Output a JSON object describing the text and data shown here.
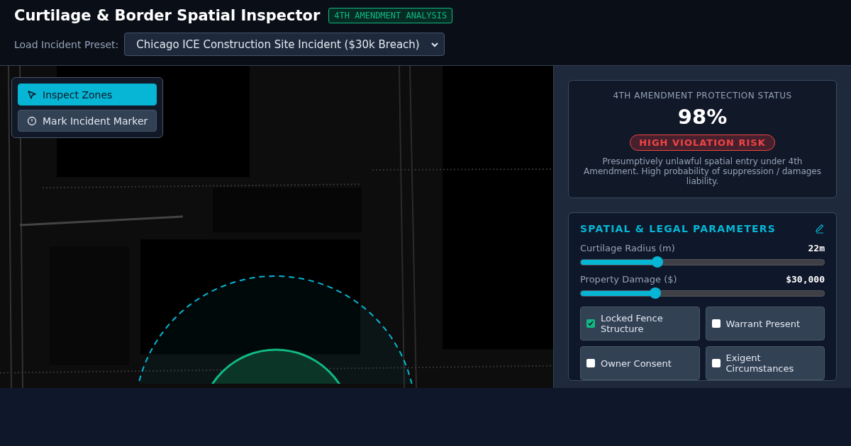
{
  "header": {
    "title": "Curtilage & Border Spatial Inspector",
    "badge": "4TH AMENDMENT ANALYSIS",
    "preset_label": "Load Incident Preset:",
    "preset_value": "Chicago ICE Construction Site Incident ($30k Breach)"
  },
  "map": {
    "kind": "picture",
    "tools": [
      {
        "kind": "pointer",
        "label": "Inspect Zones",
        "selected": true
      },
      {
        "kind": "marker",
        "label": "Mark Incident Marker",
        "selected": false
      }
    ]
  },
  "status": {
    "heading": "4TH AMENDMENT PROTECTION STATUS",
    "score": "98%",
    "risk": "HIGH VIOLATION RISK",
    "description": "Presumptively unlawful spatial entry under 4th Amendment. High probability of suppression / damages liability."
  },
  "parameters": {
    "title": "SPATIAL & LEGAL PARAMETERS",
    "sliders": [
      {
        "label": "Curtilage Radius (m)",
        "reading": "22m",
        "level": 0.316
      },
      {
        "label": "Property Damage ($)",
        "reading": "$30,000",
        "level": 0.307
      }
    ],
    "toggles": [
      {
        "label": "Locked Fence Structure",
        "checked": true
      },
      {
        "label": "Warrant Present",
        "checked": false
      },
      {
        "label": "Owner Consent",
        "checked": false
      },
      {
        "label": "Exigent Circumstances",
        "checked": false
      }
    ]
  }
}
